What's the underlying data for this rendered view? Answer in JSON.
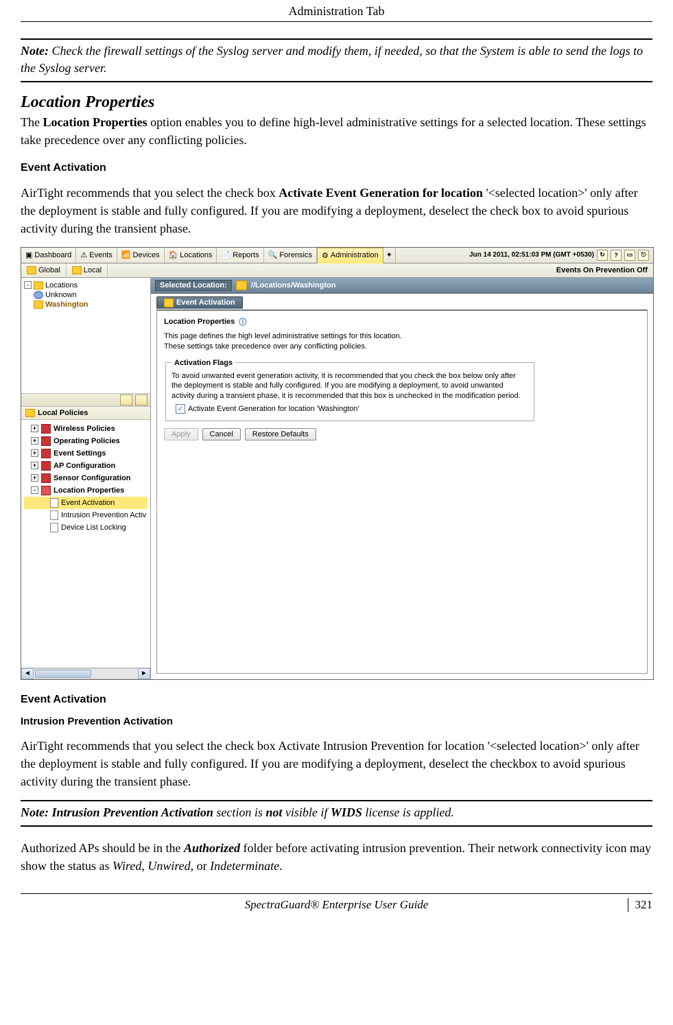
{
  "header": {
    "title": "Administration Tab"
  },
  "note1": {
    "label": "Note:",
    "text": " Check the firewall settings of the Syslog server and modify them, if needed, so that the System is able to send the logs to the Syslog server."
  },
  "section": {
    "heading": "Location Properties",
    "para1a": "The ",
    "para1b": "Location Properties",
    "para1c": " option enables you to define high-level administrative settings for a selected location. These settings take precedence over any conflicting policies."
  },
  "eventActivation": {
    "heading": "Event Activation",
    "para_a": "AirTight recommends that you select the check box ",
    "para_b": "Activate Event Generation for location",
    "para_c": " '<selected location>' only after the deployment is stable and fully configured. If you are modifying a deployment, deselect the check box to avoid spurious activity during the transient phase."
  },
  "app": {
    "tabs": [
      "Dashboard",
      "Events",
      "Devices",
      "Locations",
      "Reports",
      "Forensics",
      "Administration"
    ],
    "tab_icons": [
      "▣",
      "⚠",
      "📶",
      "🏠",
      "📄",
      "🔍",
      "⚙"
    ],
    "timestamp": "Jun 14 2011, 02:51:03 PM (GMT +0530)",
    "toolbar2": {
      "global": "Global",
      "local": "Local",
      "status": "Events On Prevention Off"
    },
    "tree": {
      "root": "Locations",
      "unknown": "Unknown",
      "washington": "Washington"
    },
    "policies_header": "Local Policies",
    "policies": [
      "Wireless Policies",
      "Operating Policies",
      "Event Settings",
      "AP Configuration",
      "Sensor Configuration",
      "Location Properties"
    ],
    "loc_prop_children": [
      "Event Activation",
      "Intrusion Prevention Activ",
      "Device List Locking"
    ],
    "selected_location_label": "Selected Location:",
    "selected_location_path": "//Locations/Washington",
    "ev_tab": "Event Activation",
    "panel": {
      "title": "Location Properties",
      "desc1": "This page defines the high level administrative settings for this location.",
      "desc2": "These settings take precedence over any conflicting policies.",
      "fieldset_legend": "Activation Flags",
      "fieldset_text": "To avoid unwanted event generation activity, it is recommended that you check the box below only after the deployment is stable and fully configured. If you are modifying a deployment, to avoid unwanted activity during a transient phase, it is recommended that this box is unchecked in the modification period.",
      "checkbox_label": "Activate Event Generation for location 'Washington'"
    },
    "buttons": {
      "apply": "Apply",
      "cancel": "Cancel",
      "restore": "Restore Defaults"
    }
  },
  "caption1": "Event Activation",
  "intrusion": {
    "heading": "Intrusion Prevention Activation",
    "para": "AirTight recommends that you select the check box Activate Intrusion Prevention for location '<selected location>' only after the deployment is stable and fully configured. If you are modifying a deployment, deselect the checkbox to avoid spurious activity during the transient phase."
  },
  "note2": {
    "p1": "Note: Intrusion Prevention Activation",
    "p2": " section is ",
    "p3": "not",
    "p4": " visible if ",
    "p5": "WIDS",
    "p6": " license is applied."
  },
  "authPara": {
    "a": "Authorized APs should be in the ",
    "b": "Authorized",
    "c": " folder before activating intrusion prevention. Their network connectivity icon may show the status as ",
    "d": "Wired",
    "e": ", ",
    "f": "Unwired",
    "g": ", or ",
    "h": "Indeterminate",
    "i": "."
  },
  "footer": {
    "guide": "SpectraGuard®  Enterprise User Guide",
    "page": "321"
  }
}
